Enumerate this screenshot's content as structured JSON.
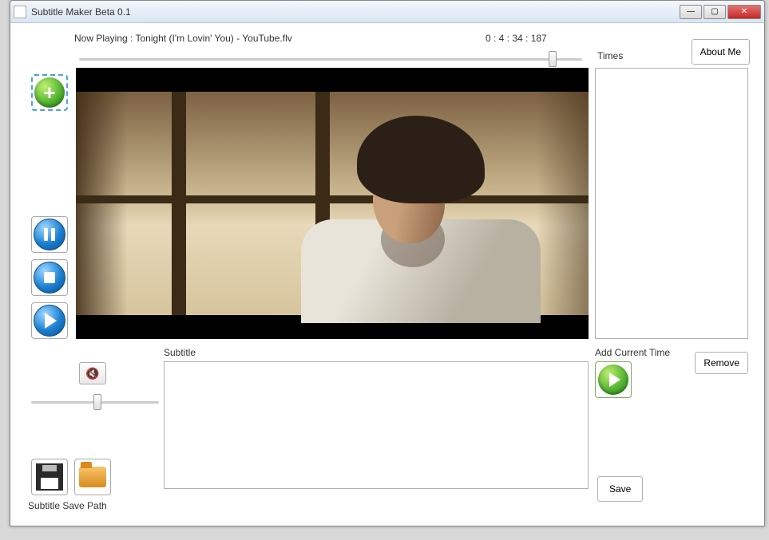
{
  "window": {
    "title": "Subtitle Maker Beta 0.1"
  },
  "header": {
    "now_playing": "Now Playing : Tonight (I'm Lovin' You) - YouTube.flv",
    "timecode": "0 : 4 : 34 : 187",
    "times_label": "Times",
    "about_label": "About Me"
  },
  "buttons": {
    "remove": "Remove",
    "save": "Save"
  },
  "labels": {
    "subtitle": "Subtitle",
    "add_current_time": "Add Current Time",
    "save_path": "Subtitle Save Path"
  },
  "subtitle_text": "",
  "times_list": [],
  "mute_glyph": "🔇",
  "playback": {
    "seek_position_percent": 93,
    "volume_percent": 50
  }
}
